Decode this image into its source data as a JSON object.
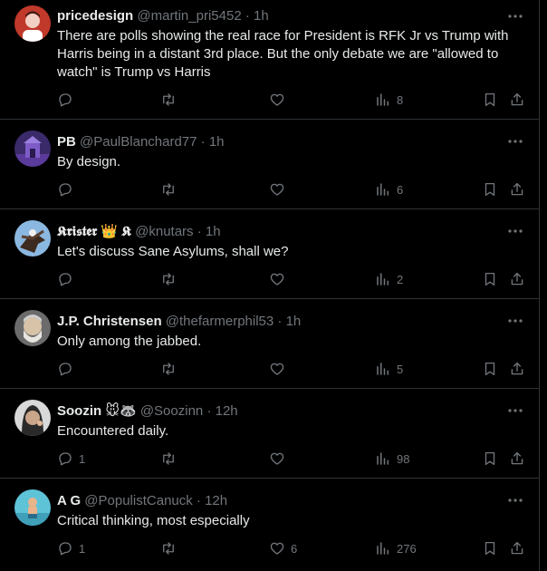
{
  "posts": [
    {
      "display_name": "pricedesign",
      "handle": "@martin_pri5452",
      "time": "1h",
      "text": "There are polls showing the real race for President is RFK Jr vs Trump with Harris being in a distant 3rd place. But the only debate we are \"allowed to watch\" is Trump vs Harris",
      "replies": "",
      "reposts": "",
      "likes": "",
      "views": "8",
      "avatar_colors": [
        "#c0392b",
        "#f2d0c4"
      ]
    },
    {
      "display_name": "PB",
      "handle": "@PaulBlanchard77",
      "time": "1h",
      "text": "By design.",
      "replies": "",
      "reposts": "",
      "likes": "",
      "views": "6",
      "avatar_colors": [
        "#3a2a6a",
        "#7d5cc8"
      ]
    },
    {
      "display_name": "𝕶𝖗𝖎𝖘𝖙𝖊𝖗 👑 𝕶",
      "handle": "@knutars",
      "time": "1h",
      "text": "Let's discuss Sane Asylums, shall we?",
      "replies": "",
      "reposts": "",
      "likes": "",
      "views": "2",
      "avatar_colors": [
        "#8bb8e0",
        "#3d2b1f"
      ]
    },
    {
      "display_name": "J.P. Christensen",
      "handle": "@thefarmerphil53",
      "time": "1h",
      "text": "Only among the jabbed.",
      "replies": "",
      "reposts": "",
      "likes": "",
      "views": "5",
      "avatar_colors": [
        "#6b6b6b",
        "#d8c3a8"
      ]
    },
    {
      "display_name": "Soozin 🐭🦝",
      "handle": "@Soozinn",
      "time": "12h",
      "text": "Encountered daily.",
      "replies": "1",
      "reposts": "",
      "likes": "",
      "views": "98",
      "avatar_colors": [
        "#d9d9d9",
        "#2a2a2a"
      ]
    },
    {
      "display_name": "A G",
      "handle": "@PopulistCanuck",
      "time": "12h",
      "text": "Critical thinking, most especially",
      "replies": "1",
      "reposts": "",
      "likes": "6",
      "views": "276",
      "avatar_colors": [
        "#5fc3d8",
        "#e9b48a"
      ]
    }
  ],
  "icons": {
    "more": "more-horizontal-icon",
    "reply": "reply-icon",
    "repost": "repost-icon",
    "like": "heart-icon",
    "views": "views-icon",
    "bookmark": "bookmark-icon",
    "share": "share-icon"
  },
  "colors": {
    "background": "#000000",
    "text": "#e7e9ea",
    "muted": "#71767b",
    "divider": "#2f3336"
  }
}
